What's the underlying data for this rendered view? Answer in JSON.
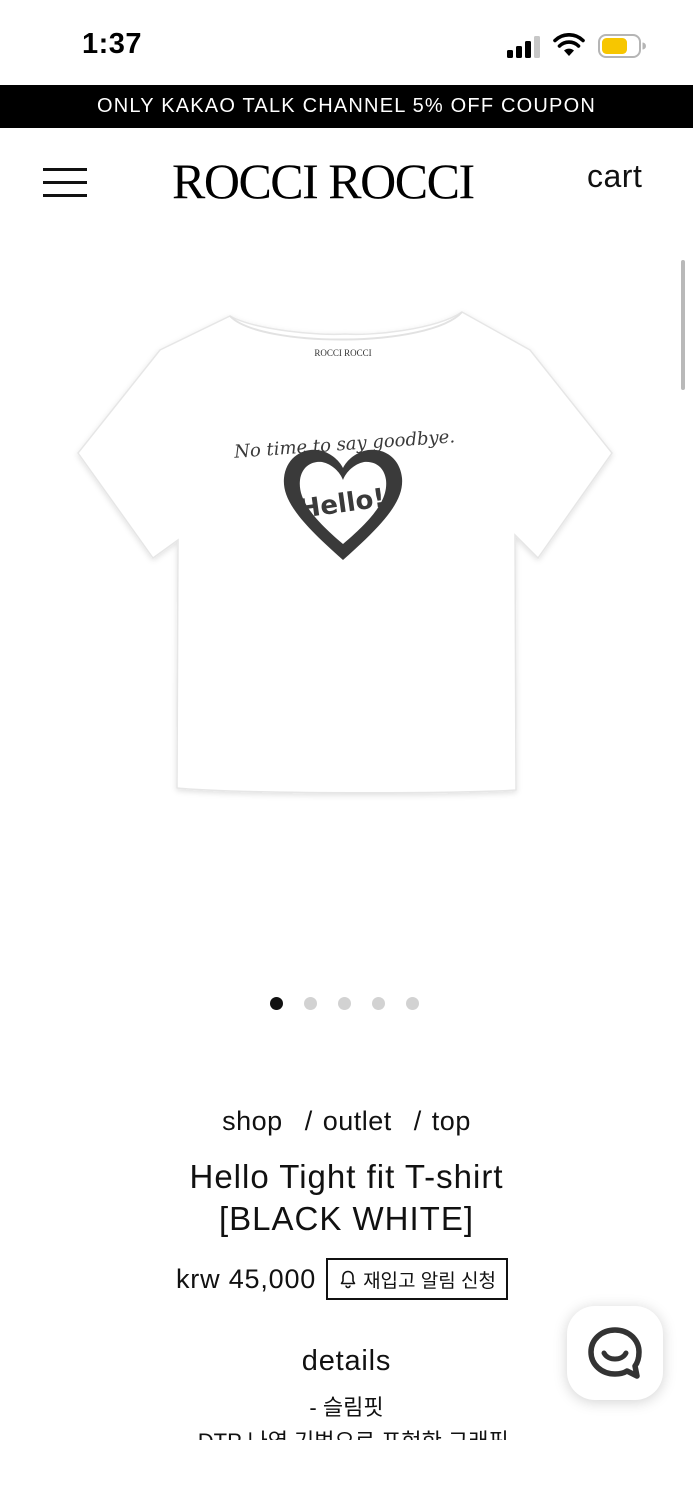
{
  "status_bar": {
    "time": "1:37"
  },
  "banner": {
    "text": "ONLY KAKAO TALK CHANNEL 5% OFF COUPON"
  },
  "header": {
    "logo": "ROCCI ROCCI",
    "cart_label": "cart",
    "menu_icon": "hamburger-menu-icon"
  },
  "product": {
    "image": {
      "neck_label": "ROCCI ROCCI",
      "print_script": "No time to say goodbye.",
      "print_heart_word": "Hello!",
      "garment_color": "#ffffff",
      "print_color": "#3a3a3a"
    },
    "carousel": {
      "count": 5,
      "active_index": 0
    },
    "breadcrumb": [
      "shop",
      "outlet",
      "top"
    ],
    "breadcrumb_separator": "/",
    "title_line1": "Hello Tight fit T-shirt",
    "title_line2": "[BLACK WHITE]",
    "price": "krw 45,000",
    "restock_button": "재입고 알림 신청",
    "details_heading": "details",
    "details": [
      "- 슬림핏",
      "- DTP 나염 기법으로 표현한 그래픽"
    ]
  },
  "chat": {
    "icon": "chat-bubble-icon"
  },
  "colors": {
    "banner_bg": "#000000",
    "text": "#111111",
    "dot_inactive": "#d2d2d2",
    "dot_active": "#111111"
  }
}
